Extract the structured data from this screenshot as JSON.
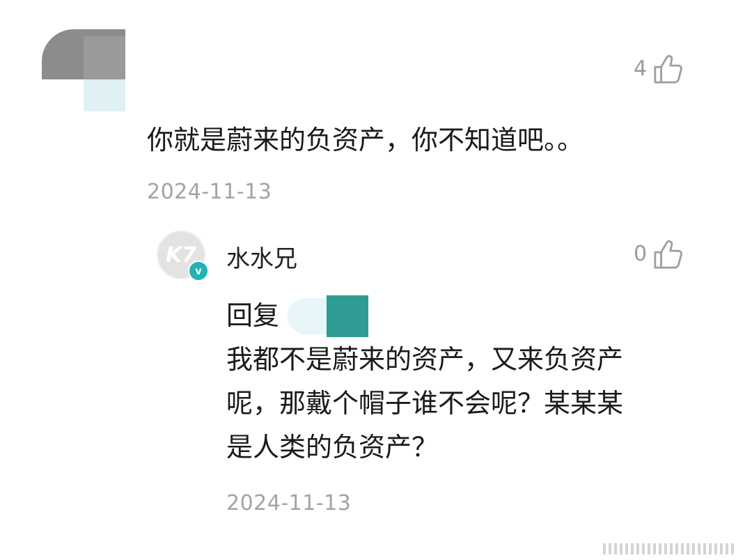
{
  "comment": {
    "like_count": "4",
    "text": "你就是蔚来的负资产，你不知道吧。。",
    "date": "2024-11-13",
    "like_icon": "thumbs-up-icon"
  },
  "reply": {
    "author": "水水兄",
    "avatar_monogram": "K7",
    "verified_mark": "v",
    "like_count": "0",
    "prefix": "回复",
    "lines": [
      "我都不是蔚来的资产，又来负资产",
      "呢，那戴个帽子谁不会呢？某某某",
      "是人类的负资产？"
    ],
    "date": "2024-11-13",
    "like_icon": "thumbs-up-icon"
  },
  "colors": {
    "text": "#1a1a1a",
    "muted": "#a3a3a3",
    "verified": "#1fb3b3"
  }
}
